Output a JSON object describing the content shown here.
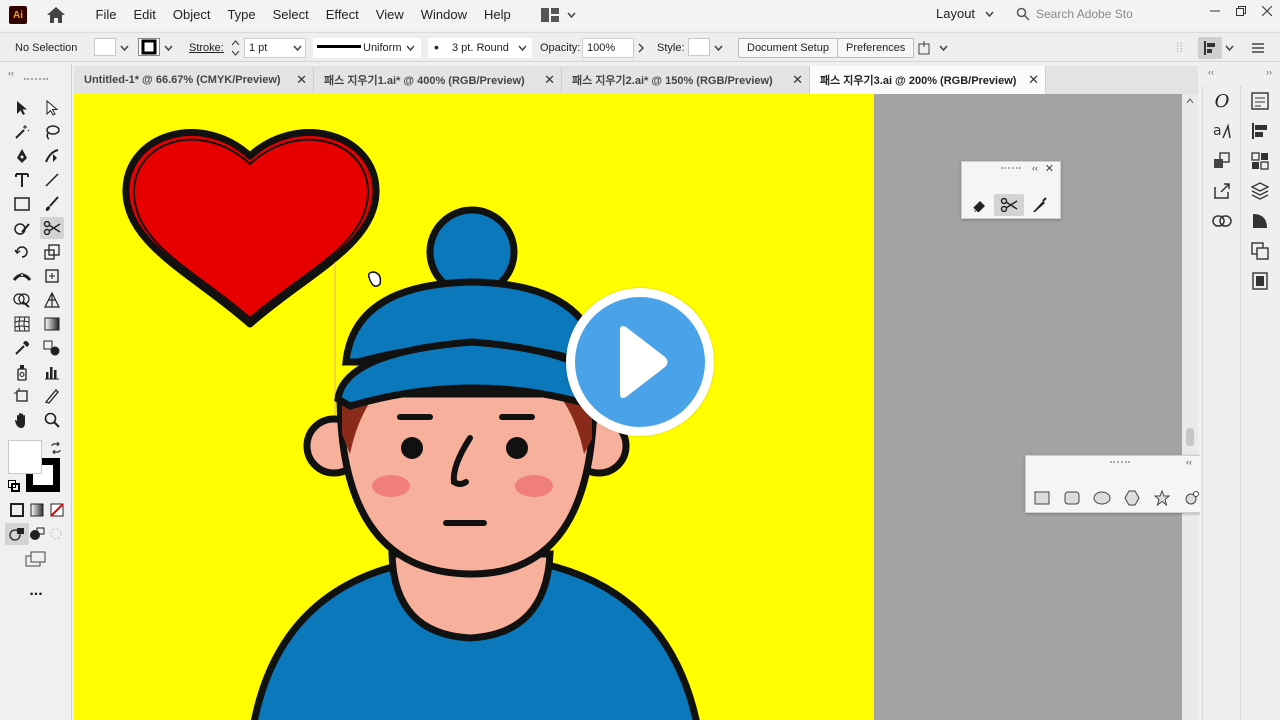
{
  "app": {
    "logo_text": "Ai"
  },
  "menu": [
    "File",
    "Edit",
    "Object",
    "Type",
    "Select",
    "Effect",
    "View",
    "Window",
    "Help"
  ],
  "workspace": {
    "label": "Layout"
  },
  "search": {
    "placeholder": "Search Adobe Sto"
  },
  "control_bar": {
    "selection": "No Selection",
    "stroke_label": "Stroke:",
    "stroke_weight": "1 pt",
    "profile": "Uniform",
    "brush": "3 pt. Round",
    "opacity_label": "Opacity:",
    "opacity": "100%",
    "style_label": "Style:",
    "document_setup": "Document Setup",
    "preferences": "Preferences"
  },
  "tabs": [
    {
      "label": "Untitled-1* @ 66.67% (CMYK/Preview)",
      "active": false
    },
    {
      "label": "패스 지우기1.ai* @ 400% (RGB/Preview)",
      "active": false
    },
    {
      "label": "패스 지우기2.ai* @ 150% (RGB/Preview)",
      "active": false
    },
    {
      "label": "패스 지우기3.ai @ 200% (RGB/Preview)",
      "active": true
    }
  ],
  "tools_panel": {
    "active_tool": "scissors-tool",
    "more": "..."
  },
  "eraser_panel": {
    "tools": [
      "eraser-tool",
      "scissors-tool",
      "knife-tool"
    ],
    "active": "scissors-tool"
  },
  "shape_panel": {
    "tools": [
      "rectangle-tool",
      "rounded-rectangle-tool",
      "ellipse-tool",
      "polygon-tool",
      "star-tool",
      "flare-tool"
    ]
  },
  "artwork": {
    "background": "#fffd00",
    "heart_color": "#e60000",
    "hat_color": "#0a78ba",
    "skin_color": "#f7b09c",
    "blush_color": "#f07f7a",
    "shirt_color": "#0a78ba",
    "outline_color": "#111111"
  },
  "play_button": {
    "color": "#4aa3e8"
  }
}
